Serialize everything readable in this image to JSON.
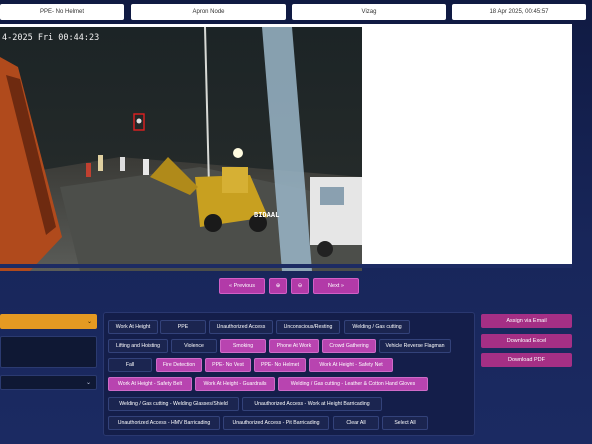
{
  "topbar": {
    "detection": "PPE- No Helmet",
    "node": "Apron Node",
    "location": "Vizag",
    "datetime": "18 Apr 2025, 00:45:57"
  },
  "feed": {
    "timestamp_overlay": "4-2025 Fri 00:44:23",
    "brand_overlay": "BIDAAL"
  },
  "nav": {
    "previous": "« Previous",
    "zoom_in": "⊕",
    "zoom_out": "⊖",
    "next": "Next »"
  },
  "left": {
    "select_top_chevron": "⌄",
    "select_bottom_chevron": "⌄"
  },
  "tags": [
    {
      "label": "Work At Height",
      "active": false
    },
    {
      "label": "PPE",
      "active": false
    },
    {
      "label": "Unauthorized Access",
      "active": false
    },
    {
      "label": "Unconscious/Resting",
      "active": false
    },
    {
      "label": "Welding / Gas cutting",
      "active": false
    },
    {
      "label": "Lifting and Hoisting",
      "active": false
    },
    {
      "label": "Violence",
      "active": false
    },
    {
      "label": "Smoking",
      "active": true
    },
    {
      "label": "Phone At Work",
      "active": true
    },
    {
      "label": "Crowd Gathering",
      "active": true
    },
    {
      "label": "Vehicle Reverse Flagman",
      "active": false
    },
    {
      "label": "Fall",
      "active": false
    },
    {
      "label": "Fire Detection",
      "active": true
    },
    {
      "label": "PPE- No Vest",
      "active": true
    },
    {
      "label": "PPE- No Helmet",
      "active": true
    },
    {
      "label": "Work At Height - Safety Net",
      "active": true
    },
    {
      "label": "Work At Height - Safety Belt",
      "active": true
    },
    {
      "label": "Work At Height - Guardrails",
      "active": true
    },
    {
      "label": "Welding / Gas cutting - Leather & Cotton Hand Gloves",
      "active": true
    },
    {
      "label": "Welding / Gas cutting - Welding Glasses/Shield",
      "active": false
    },
    {
      "label": "Unauthorized Access - Work at Height Barricading",
      "active": false
    },
    {
      "label": "Unauthorized Access - HMV Barricading",
      "active": false
    },
    {
      "label": "Unauthorized Access - Pit Barricading",
      "active": false
    },
    {
      "label": "Clear All",
      "active": false
    },
    {
      "label": "Select All",
      "active": false
    }
  ],
  "actions": {
    "assign": "Assign via Email",
    "excel": "Download Excel",
    "pdf": "Download PDF"
  },
  "colors": {
    "accent": "#b844b0",
    "orange_select": "#e59a22",
    "background": "#18265a"
  }
}
